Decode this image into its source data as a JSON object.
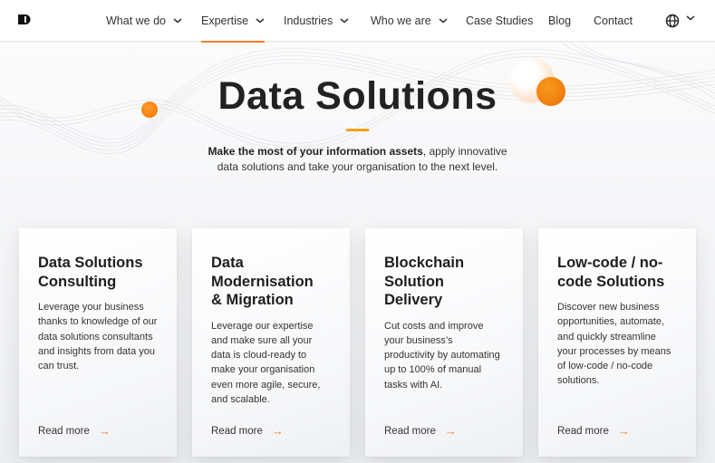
{
  "navbar": {
    "logo": "logo-icon",
    "items": [
      {
        "label": "What we do",
        "has_dropdown": true,
        "active": false
      },
      {
        "label": "Expertise",
        "has_dropdown": true,
        "active": true
      },
      {
        "label": "Industries",
        "has_dropdown": true,
        "active": false
      },
      {
        "label": "Who we are",
        "has_dropdown": true,
        "active": false
      },
      {
        "label": "Case Studies",
        "has_dropdown": false,
        "active": false
      },
      {
        "label": "Blog",
        "has_dropdown": false,
        "active": false
      },
      {
        "label": "Contact",
        "has_dropdown": false,
        "active": false
      }
    ],
    "language_icon": "globe-icon"
  },
  "hero": {
    "title": "Data Solutions",
    "subtitle_bold": "Make the most of your information assets",
    "subtitle_rest_line1": ", apply innovative",
    "subtitle_line2": "data solutions and take your organisation to the next level."
  },
  "cards": [
    {
      "title": "Data Solutions Consulting",
      "text": "Leverage your business thanks to knowledge of our data solutions consultants and insights from data you can trust.",
      "link": "Read more"
    },
    {
      "title": "Data Modernisation & Migration",
      "text": "Leverage our expertise and make sure all your data is cloud-ready to make your organisation even more agile, secure, and scalable.",
      "link": "Read more"
    },
    {
      "title": "Blockchain Solution Delivery",
      "text": "Cut costs and improve your business’s productivity by automating up to 100% of manual tasks with AI.",
      "link": "Read more"
    },
    {
      "title": "Low-code / no-code Solutions",
      "text": "Discover new business opportunities, automate, and quickly streamline your processes by means of low-code / no-code solutions.",
      "link": "Read more"
    }
  ],
  "colors": {
    "accent": "#f07f2a",
    "divider": "#f5a11c",
    "text": "#222222"
  }
}
